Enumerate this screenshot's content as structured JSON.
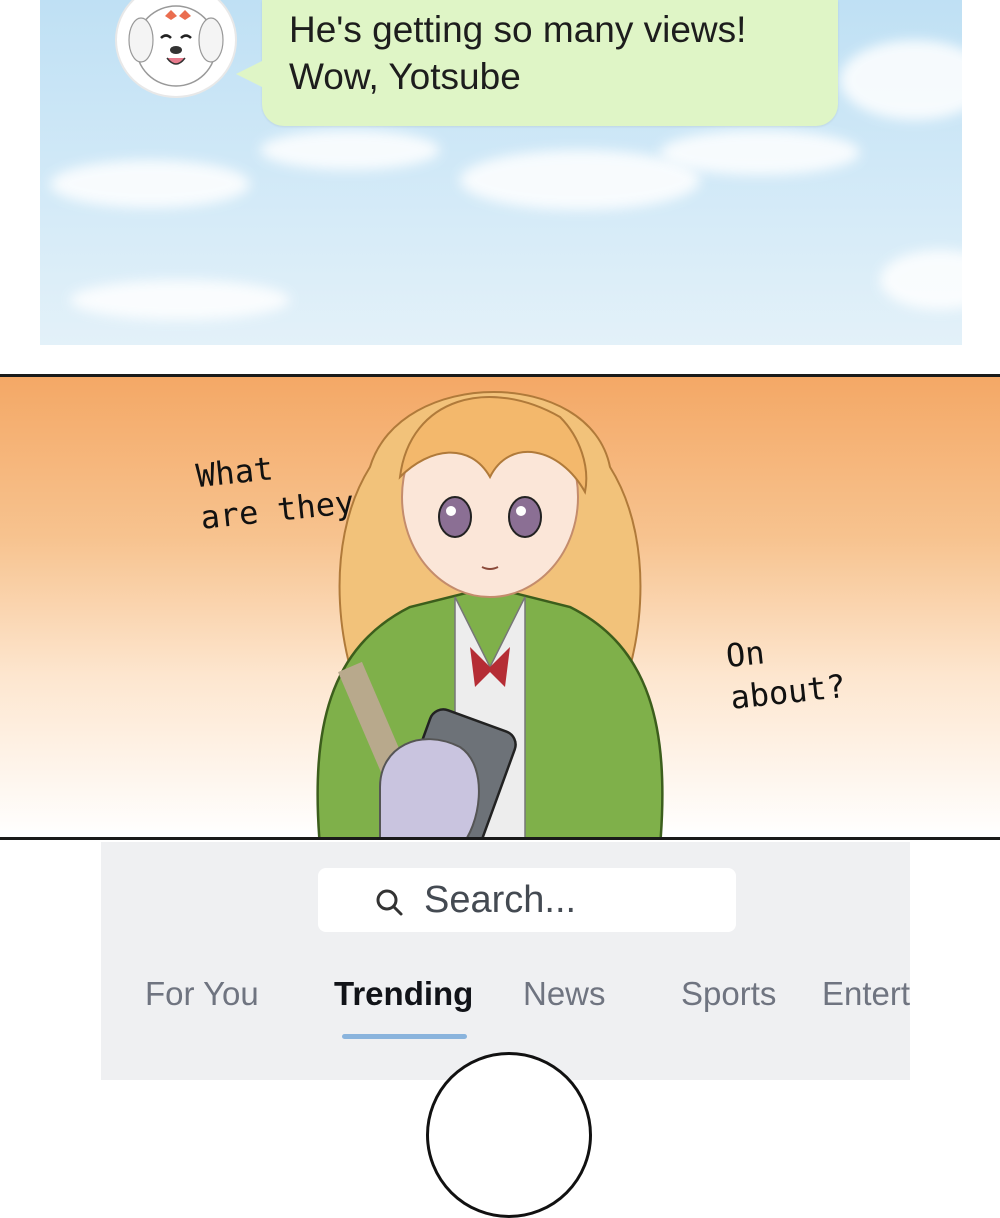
{
  "chat": {
    "message": "He's getting so many views!\nWow, Yotsube"
  },
  "speech": {
    "left": "What\nare they",
    "right": "On\nabout?"
  },
  "app": {
    "search": {
      "placeholder": "Search..."
    },
    "tabs": [
      {
        "label": "For You",
        "active": false
      },
      {
        "label": "Trending",
        "active": true
      },
      {
        "label": "News",
        "active": false
      },
      {
        "label": "Sports",
        "active": false
      },
      {
        "label": "Entert",
        "active": false
      }
    ]
  },
  "colors": {
    "chat_bubble": "#dff5c6",
    "sky": "#cfe8f7",
    "panel_gradient_top": "#f4a866",
    "app_background": "#eff0f2",
    "tab_underline": "#8ab4dd"
  }
}
